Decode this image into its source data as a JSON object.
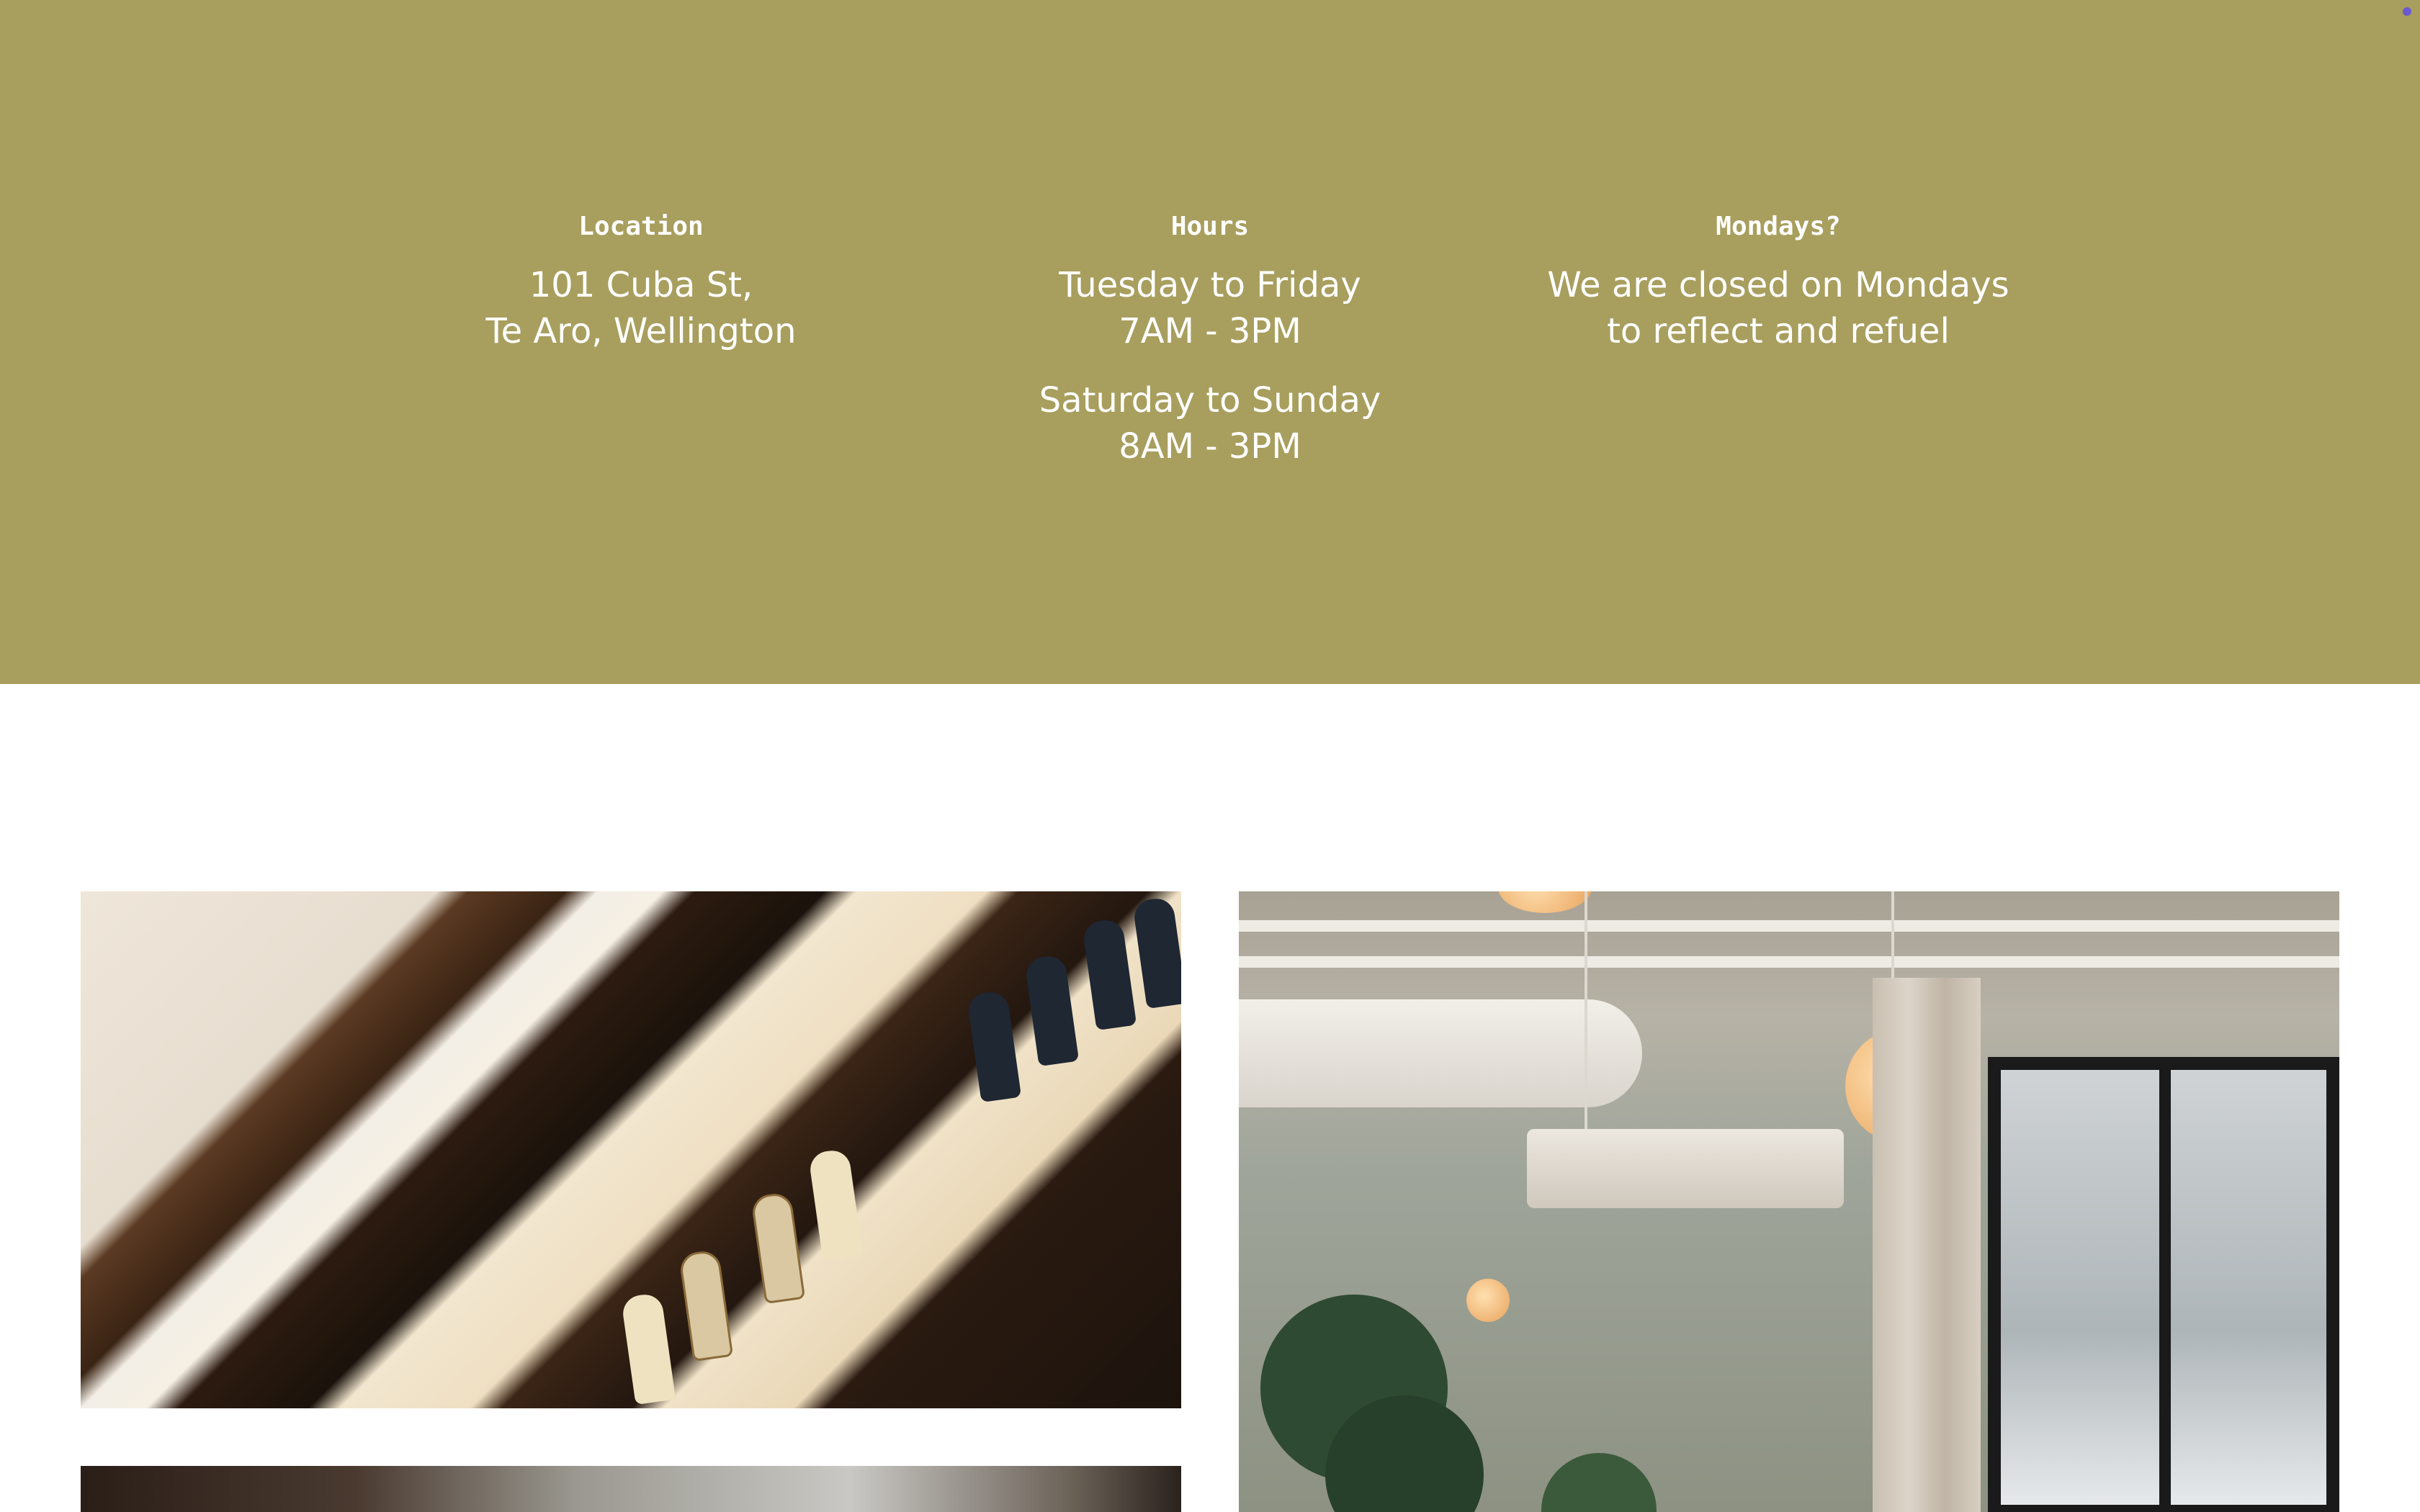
{
  "info": {
    "location": {
      "heading": "Location",
      "line1": "101 Cuba St,",
      "line2": "Te Aro, Wellington"
    },
    "hours": {
      "heading": "Hours",
      "weekday_days": "Tuesday to Friday",
      "weekday_time": "7AM - 3PM",
      "weekend_days": "Saturday to Sunday",
      "weekend_time": "8AM - 3PM"
    },
    "mondays": {
      "heading": "Mondays?",
      "line1": "We are closed on Mondays",
      "line2": "to reflect and refuel"
    }
  },
  "colors": {
    "band": "#a89e5e",
    "text": "#ffffff"
  },
  "gallery": {
    "photos": [
      "wine-shelves-photo",
      "cafe-interior-photo",
      "kitchen-photo"
    ]
  }
}
